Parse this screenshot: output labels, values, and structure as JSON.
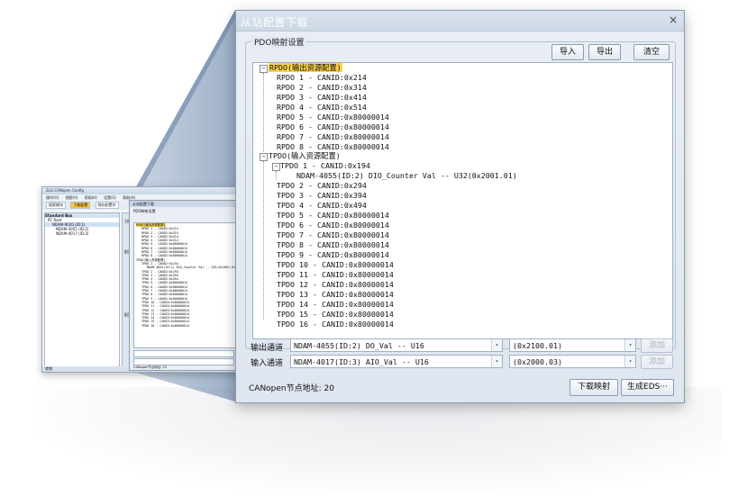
{
  "mini": {
    "title": "ZLG CANopen Config",
    "menu": [
      "操作(O)",
      "视图(V)",
      "帮助(H)",
      "设置(S)",
      "帮助(H)"
    ],
    "toolbar": [
      "搜索模块",
      "下载配置",
      "保存配置并"
    ],
    "tree_header": "Standard Bus",
    "tree_items": [
      "PC   Root",
      "NDAM-9020 (ID:1)",
      "NDAM-4055 (ID:2)",
      "NDAM-4017 (ID:3)"
    ],
    "side_labels": [
      "当前器",
      "配置信",
      "配置信"
    ],
    "status": "就绪"
  },
  "dialog": {
    "title": "从站配置下载",
    "close": "×",
    "group_label": "PDO映射设置",
    "buttons": {
      "import": "导入",
      "export": "导出",
      "clear": "清空",
      "add1": "添加",
      "add2": "添加",
      "download": "下载映射",
      "generate": "生成EDS···"
    },
    "rpdo_root": "RPDO(输出资源配置)",
    "rpdo": [
      "RPDO 1 - CANID:0x214",
      "RPDO 2 - CANID:0x314",
      "RPDO 3 - CANID:0x414",
      "RPDO 4 - CANID:0x514",
      "RPDO 5 - CANID:0x80000014",
      "RPDO 6 - CANID:0x80000014",
      "RPDO 7 - CANID:0x80000014",
      "RPDO 8 - CANID:0x80000014"
    ],
    "tpdo_root": "TPDO(输入资源配置)",
    "tpdo1": "TPDO 1 - CANID:0x194",
    "tpdo1_child": "NDAM-4055(ID:2) DIO_Counter Val -- U32(0x2001.01)",
    "tpdo": [
      "TPDO 2 - CANID:0x294",
      "TPDO 3 - CANID:0x394",
      "TPDO 4 - CANID:0x494",
      "TPDO 5 - CANID:0x80000014",
      "TPDO 6 - CANID:0x80000014",
      "TPDO 7 - CANID:0x80000014",
      "TPDO 8 - CANID:0x80000014",
      "TPDO 9 - CANID:0x80000014",
      "TPDO 10 - CANID:0x80000014",
      "TPDO 11 - CANID:0x80000014",
      "TPDO 12 - CANID:0x80000014",
      "TPDO 13 - CANID:0x80000014",
      "TPDO 14 - CANID:0x80000014",
      "TPDO 15 - CANID:0x80000014",
      "TPDO 16 - CANID:0x80000014"
    ],
    "output_label": "输出通道",
    "output_value": "NDAM-4055(ID:2) DO_Val -- U16",
    "output_index": "(0x2100.01)",
    "input_label": "输入通道",
    "input_value": "NDAM-4017(ID:3) AIO_Val -- U16",
    "input_index": "(0x2000.03)",
    "node_address": "CANopen节点地址: 20"
  }
}
